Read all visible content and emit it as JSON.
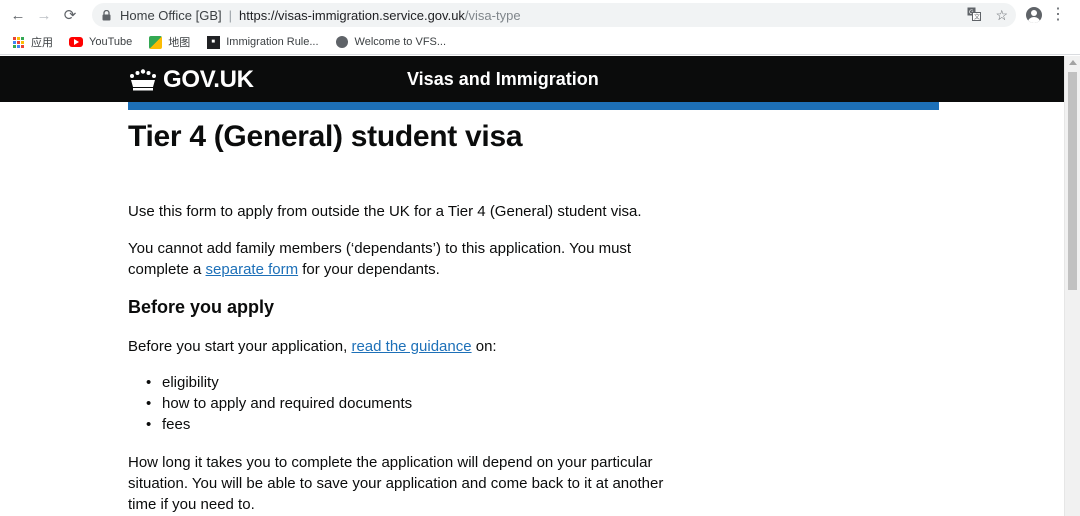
{
  "browser": {
    "back_icon": "←",
    "forward_icon": "→",
    "reload_icon": "⟳",
    "site_identity": "Home Office [GB]",
    "url_host": "https://visas-immigration.service.gov.uk",
    "url_path": "/visa-type",
    "translate_icon": "translate-icon",
    "star_icon": "☆",
    "menu_icon": "⋮"
  },
  "bookmarks": [
    {
      "label": "应用",
      "icon": "apps-icon"
    },
    {
      "label": "YouTube",
      "icon": "youtube-icon"
    },
    {
      "label": "地图",
      "icon": "maps-icon"
    },
    {
      "label": "Immigration Rule...",
      "icon": "immigration-rules-icon"
    },
    {
      "label": "Welcome to VFS...",
      "icon": "globe-icon"
    }
  ],
  "header": {
    "logo_text": "GOV.UK",
    "service_name": "Visas and Immigration",
    "colors": {
      "header_bg": "#0b0c0c",
      "accent_bar": "#1d70b8",
      "link": "#1d70b8"
    }
  },
  "main": {
    "title": "Tier 4 (General) student visa",
    "intro": "Use this form to apply from outside the UK for a Tier 4 (General) student visa.",
    "dependants_before": "You cannot add family members (‘dependants’) to this application. You must complete a ",
    "dependants_link": "separate form",
    "dependants_after": " for your dependants.",
    "before_heading": "Before you apply",
    "guidance_before": "Before you start your application, ",
    "guidance_link": "read the guidance",
    "guidance_after": " on:",
    "guidance_items": [
      "eligibility",
      "how to apply and required documents",
      "fees"
    ],
    "time_text": "How long it takes you to complete the application will depend on your particular situation. You will be able to save your application and come back to it at another time if you need to."
  }
}
